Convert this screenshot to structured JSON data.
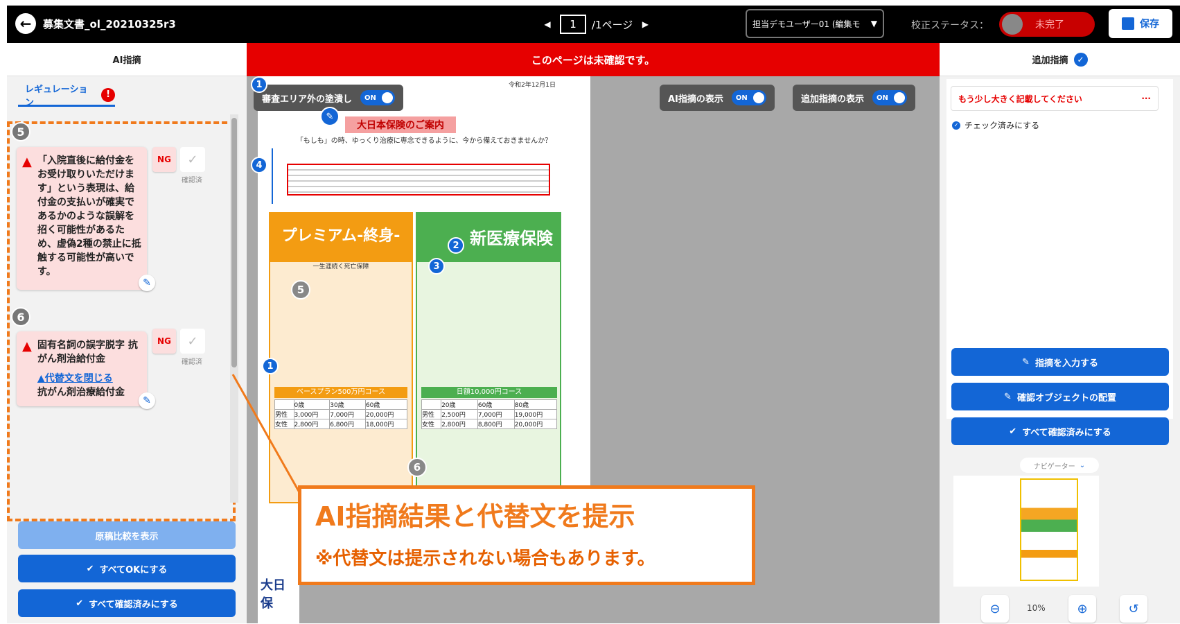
{
  "topbar": {
    "document_title": "募集文書_ol_20210325r3",
    "page_current": "1",
    "page_total": "/1ページ",
    "user_select": "担当デモユーザー01 (編集モ",
    "status_label": "校正ステータス：",
    "status_value": "未完了",
    "save_label": "保存"
  },
  "left_header": "AI指摘",
  "banner": "このページは未確認です。",
  "right_header": "追加指摘",
  "left_panel": {
    "tab_label": "レギュレーション",
    "tab_badge": "!",
    "items": [
      {
        "number": "5",
        "text": "「入院直後に給付金をお受け取りいただけます」という表現は、給付金の支払いが確実であるかのような誤解を招く可能性があるため、虚偽2種の禁止に抵触する可能性が高いです。",
        "ng_label": "NG",
        "confirm_label": "確認済"
      },
      {
        "number": "6",
        "text": "固有名詞の誤字脱字 抗がん剤治給付金",
        "alt_toggle": "▲代替文を閉じる",
        "alt_text": "抗がん剤治療給付金",
        "ng_label": "NG",
        "confirm_label": "確認済"
      }
    ],
    "buttons": {
      "compare": "原稿比較を表示",
      "all_ok": "すべてOKにする",
      "all_confirmed": "すべて確認済みにする"
    }
  },
  "canvas": {
    "toggle_outside": "審査エリア外の塗潰し",
    "toggle_ai": "AI指摘の表示",
    "toggle_additional": "追加指摘の表示",
    "toggle_on": "ON",
    "doc_date": "令和2年12月1日",
    "doc_heading": "大日本保険のご案内",
    "doc_lead": "「もしも」の時、ゆっくり治療に専念できるように、今から備えておきませんか？",
    "product_left": "プレミアム-終身-",
    "product_left_sub": "一生涯続く死亡保障",
    "product_right": "新医療保険",
    "plan_left": "ベースプラン500万円コース",
    "plan_right": "日額10,000円コース",
    "table_left": {
      "headers": [
        "",
        "0歳",
        "30歳",
        "60歳"
      ],
      "rows": [
        [
          "男性",
          "3,000円",
          "7,000円",
          "20,000円"
        ],
        [
          "女性",
          "2,800円",
          "6,800円",
          "18,000円"
        ]
      ]
    },
    "table_right": {
      "headers": [
        "",
        "20歳",
        "60歳",
        "80歳"
      ],
      "rows": [
        [
          "男性",
          "2,500円",
          "7,000円",
          "19,000円"
        ],
        [
          "女性",
          "2,800円",
          "8,800円",
          "20,000円"
        ]
      ]
    },
    "lower_logo_text": "大日 保"
  },
  "callout": {
    "title": "AI指摘結果と代替文を提示",
    "note": "※代替文は提示されない場合もあります。"
  },
  "right_panel": {
    "comment_text": "もう少し大きく記載してください",
    "comment_more": "···",
    "check_label": "チェック済みにする",
    "buttons": {
      "input": "指摘を入力する",
      "place_object": "確認オブジェクトの配置",
      "all_confirmed": "すべて確認済みにする"
    },
    "navigator_label": "ナビゲーター",
    "zoom_value": "10%"
  },
  "colors": {
    "accent_blue": "#1366d6",
    "alert_red": "#e60000",
    "callout_orange": "#f07a1c"
  }
}
